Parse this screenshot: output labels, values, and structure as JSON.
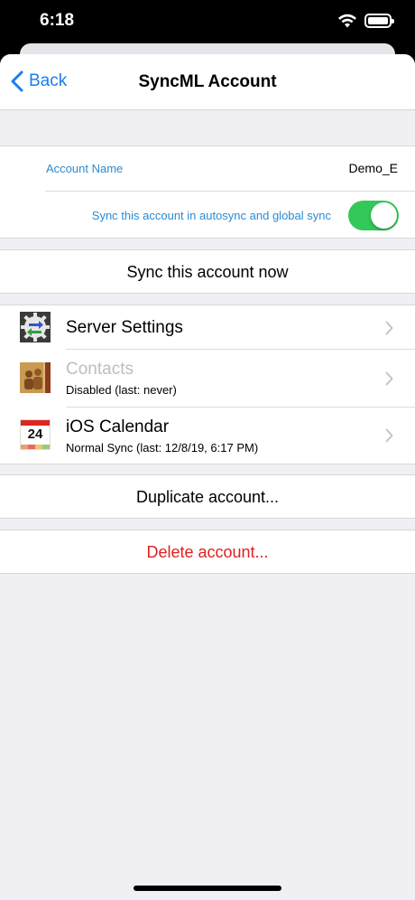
{
  "status": {
    "time": "6:18"
  },
  "nav": {
    "back_label": "Back",
    "title": "SyncML Account"
  },
  "account": {
    "name_label": "Account Name",
    "name_value": "Demo_E",
    "autosync_label": "Sync this account in autosync and global sync",
    "autosync_on": true
  },
  "actions": {
    "sync_now": "Sync this account now",
    "duplicate": "Duplicate account...",
    "delete": "Delete account..."
  },
  "items": [
    {
      "title": "Server Settings",
      "subtitle": "",
      "icon": "gear-sync-icon",
      "enabled": true
    },
    {
      "title": "Contacts",
      "subtitle": "Disabled (last: never)",
      "icon": "contacts-book-icon",
      "enabled": false
    },
    {
      "title": "iOS Calendar",
      "subtitle": "Normal Sync (last: 12/8/19, 6:17 PM)",
      "icon": "calendar-icon",
      "enabled": true,
      "calendar_day": "24"
    }
  ],
  "colors": {
    "accent": "#1a7cf2",
    "toggle_on": "#34c759",
    "destructive": "#e02020",
    "background": "#efeff4"
  }
}
